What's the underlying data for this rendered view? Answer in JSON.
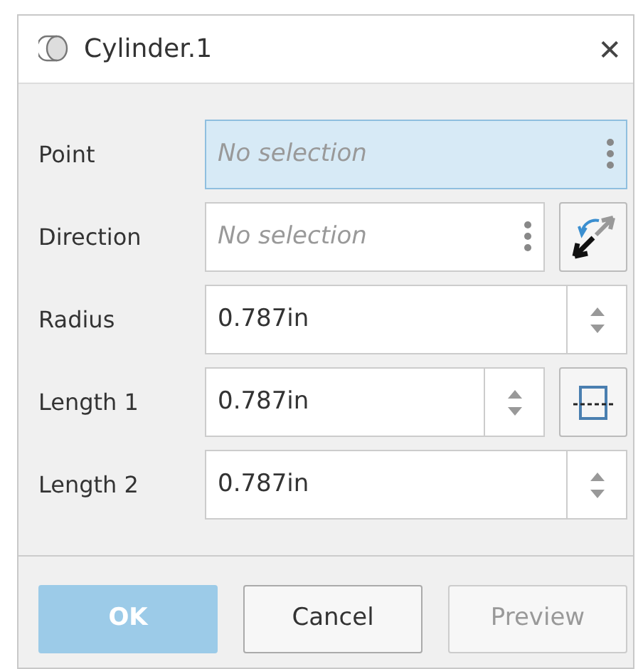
{
  "window": {
    "title": "Cylinder.1",
    "close": "✕"
  },
  "fields": [
    {
      "label": "Point",
      "kind": "selection",
      "placeholder": "No selection",
      "selected": true
    },
    {
      "label": "Direction",
      "kind": "selection",
      "placeholder": "No selection",
      "selected": false,
      "extra_button": {
        "kind": "reverse"
      }
    },
    {
      "label": "Radius",
      "kind": "number",
      "value": "0.787in"
    },
    {
      "label": "Length 1",
      "kind": "number",
      "value": "0.787in",
      "extra_button": {
        "kind": "symmetry"
      }
    },
    {
      "label": "Length 2",
      "kind": "number",
      "value": "0.787in"
    }
  ],
  "buttons": [
    {
      "label": "OK",
      "kind": "primary",
      "disabled": true
    },
    {
      "label": "Cancel",
      "kind": "secondary",
      "disabled": false
    },
    {
      "label": "Preview",
      "kind": "secondary",
      "disabled": true
    }
  ]
}
